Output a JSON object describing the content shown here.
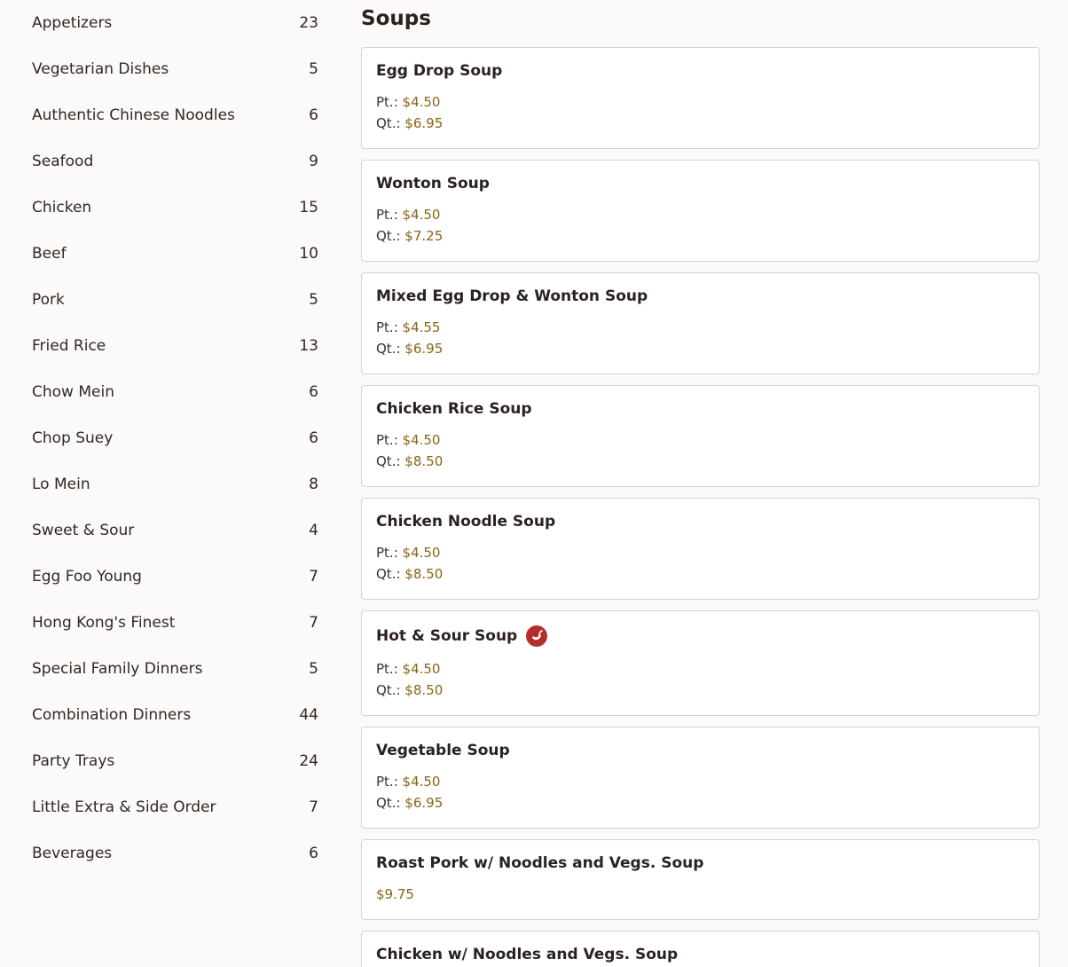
{
  "sidebar": {
    "categories": [
      {
        "label": "Appetizers",
        "count": "23"
      },
      {
        "label": "Vegetarian Dishes",
        "count": "5"
      },
      {
        "label": "Authentic Chinese Noodles",
        "count": "6"
      },
      {
        "label": "Seafood",
        "count": "9"
      },
      {
        "label": "Chicken",
        "count": "15"
      },
      {
        "label": "Beef",
        "count": "10"
      },
      {
        "label": "Pork",
        "count": "5"
      },
      {
        "label": "Fried Rice",
        "count": "13"
      },
      {
        "label": "Chow Mein",
        "count": "6"
      },
      {
        "label": "Chop Suey",
        "count": "6"
      },
      {
        "label": "Lo Mein",
        "count": "8"
      },
      {
        "label": "Sweet & Sour",
        "count": "4"
      },
      {
        "label": "Egg Foo Young",
        "count": "7"
      },
      {
        "label": "Hong Kong's Finest",
        "count": "7"
      },
      {
        "label": "Special Family Dinners",
        "count": "5"
      },
      {
        "label": "Combination Dinners",
        "count": "44"
      },
      {
        "label": "Party Trays",
        "count": "24"
      },
      {
        "label": "Little Extra & Side Order",
        "count": "7"
      },
      {
        "label": "Beverages",
        "count": "6"
      }
    ]
  },
  "main": {
    "section_title": "Soups",
    "items": [
      {
        "name": "Egg Drop Soup",
        "pt_label": "Pt.:",
        "pt_price": "$4.50",
        "qt_label": "Qt.:",
        "qt_price": "$6.95"
      },
      {
        "name": "Wonton Soup",
        "pt_label": "Pt.:",
        "pt_price": "$4.50",
        "qt_label": "Qt.:",
        "qt_price": "$7.25"
      },
      {
        "name": "Mixed Egg Drop & Wonton Soup",
        "pt_label": "Pt.:",
        "pt_price": "$4.55",
        "qt_label": "Qt.:",
        "qt_price": "$6.95"
      },
      {
        "name": "Chicken Rice Soup",
        "pt_label": "Pt.:",
        "pt_price": "$4.50",
        "qt_label": "Qt.:",
        "qt_price": "$8.50"
      },
      {
        "name": "Chicken Noodle Soup",
        "pt_label": "Pt.:",
        "pt_price": "$4.50",
        "qt_label": "Qt.:",
        "qt_price": "$8.50"
      },
      {
        "name": "Hot & Sour Soup",
        "spicy_icon": "chili-pepper-icon",
        "pt_label": "Pt.:",
        "pt_price": "$4.50",
        "qt_label": "Qt.:",
        "qt_price": "$8.50"
      },
      {
        "name": "Vegetable Soup",
        "pt_label": "Pt.:",
        "pt_price": "$4.50",
        "qt_label": "Qt.:",
        "qt_price": "$6.95"
      },
      {
        "name": "Roast Pork w/ Noodles and Vegs. Soup",
        "price": "$9.75"
      },
      {
        "name": "Chicken w/ Noodles and Vegs. Soup"
      }
    ]
  },
  "colors": {
    "background": "#fbfaf8",
    "price": "#8a6514",
    "spicy_badge": "#b3302a",
    "card_border": "#d6d2cf"
  }
}
